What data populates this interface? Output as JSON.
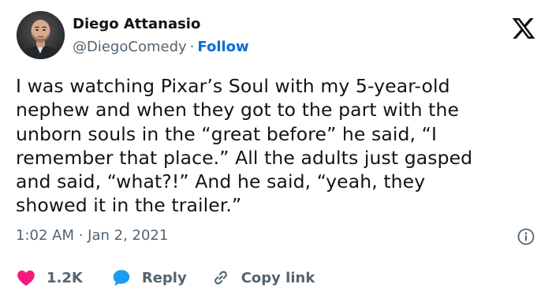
{
  "colors": {
    "text": "#0f1419",
    "secondary": "#536471",
    "follow": "#006fd6",
    "like": "#f91880",
    "reply": "#1d9bf0"
  },
  "author": {
    "name": "Diego Attanasio",
    "handle": "@DiegoComedy",
    "separator": "·",
    "follow_label": "Follow",
    "avatar_icon": "profile-photo"
  },
  "brand": {
    "logo_icon": "x-logo"
  },
  "tweet": {
    "text_lines": [
      "I was watching Pixar’s Soul with my 5-year-old",
      "nephew and when they got to the part with the",
      "unborn souls in the “great before” he said, “I",
      "remember that place.” All the adults just gasped",
      "and said, “what?!” And he said, “yeah, they",
      "showed it in the trailer.”"
    ],
    "timestamp": "1:02 AM · Jan 2, 2021",
    "info_icon": "info-icon"
  },
  "actions": {
    "likes_count": "1.2K",
    "reply_label": "Reply",
    "copy_link_label": "Copy link"
  }
}
